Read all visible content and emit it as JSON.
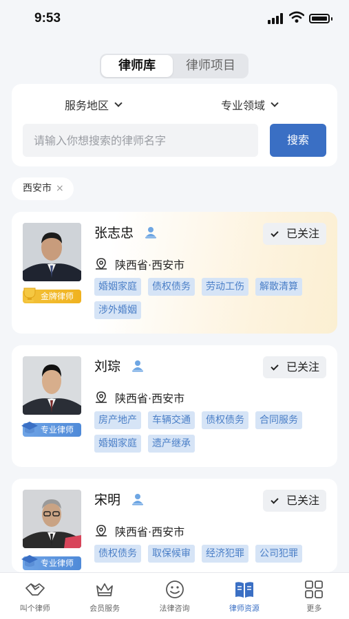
{
  "status_bar": {
    "time": "9:53"
  },
  "tabs": {
    "active": "律师库",
    "inactive": "律师项目"
  },
  "filters": {
    "region": "服务地区",
    "field": "专业领域"
  },
  "search": {
    "placeholder": "请输入你想搜索的律师名字",
    "button": "搜索"
  },
  "chip": {
    "label": "西安市",
    "remove": "×"
  },
  "colors": {
    "accent": "#3a6fc4",
    "tag_bg": "#d6e4f6",
    "tag_text": "#4b7fc7",
    "gold": "#f0b21f"
  },
  "lawyers": [
    {
      "name": "张志忠",
      "badge": "金牌律师",
      "badge_type": "gold",
      "follow": "已关注",
      "location": "陕西省·西安市",
      "tags": [
        "婚姻家庭",
        "债权债务",
        "劳动工伤",
        "解散清算",
        "涉外婚姻"
      ]
    },
    {
      "name": "刘琮",
      "badge": "专业律师",
      "badge_type": "blue",
      "follow": "已关注",
      "location": "陕西省·西安市",
      "tags": [
        "房产地产",
        "车辆交通",
        "债权债务",
        "合同服务",
        "婚姻家庭",
        "遗产继承"
      ]
    },
    {
      "name": "宋明",
      "badge": "专业律师",
      "badge_type": "blue",
      "follow": "已关注",
      "location": "陕西省·西安市",
      "tags": [
        "债权债务",
        "取保候审",
        "经济犯罪",
        "公司犯罪"
      ]
    }
  ],
  "bottom_nav": [
    {
      "label": "叫个律师",
      "icon": "handshake-icon"
    },
    {
      "label": "会员服务",
      "icon": "crown-icon"
    },
    {
      "label": "法律咨询",
      "icon": "smile-icon"
    },
    {
      "label": "律师资源",
      "icon": "book-icon",
      "active": true
    },
    {
      "label": "更多",
      "icon": "grid-icon"
    }
  ]
}
